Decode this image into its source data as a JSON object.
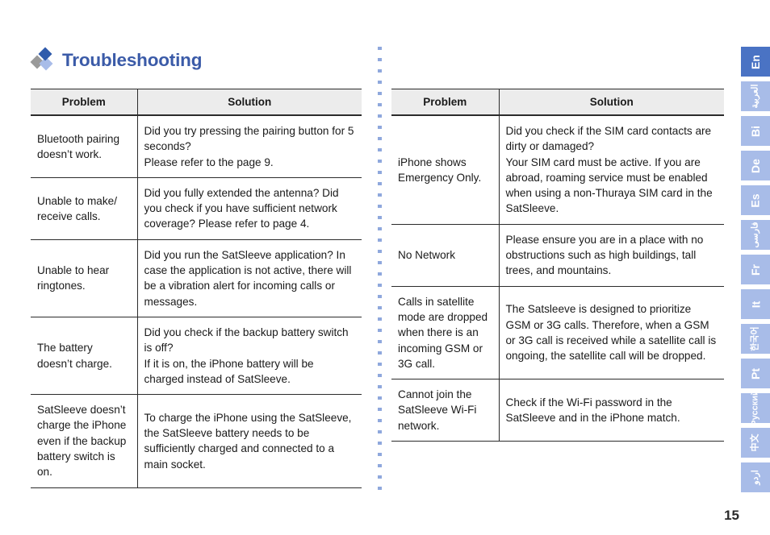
{
  "page": {
    "title": "Troubleshooting",
    "title_icon": "diamonds-icon",
    "number": "15",
    "accent_color": "#3b5ba8",
    "tab_color": "#a8bce8",
    "tab_active_color": "#4a73c4",
    "header_bg": "#ececec"
  },
  "tables": [
    {
      "name": "troubleshooting-table-left",
      "columns": [
        "Problem",
        "Solution"
      ],
      "rows": [
        {
          "problem": "Bluetooth pairing doesn’t work.",
          "solution": "Did you try pressing the pairing button for 5 seconds?\nPlease refer to the page 9."
        },
        {
          "problem": "Unable to  make/ receive calls.",
          "solution": "Did you fully extended the antenna? Did you check if you have sufficient network coverage? Please refer to page 4."
        },
        {
          "problem": "Unable to hear ringtones.",
          "solution": "Did you run the SatSleeve application? In case the application is not active, there will be a vibration alert for incoming calls or messages."
        },
        {
          "problem": "The battery doesn’t charge.",
          "solution": "Did you check if the backup battery switch is off?\nIf it is on, the iPhone battery will be charged instead of SatSleeve."
        },
        {
          "problem": "SatSleeve doesn’t charge the iPhone even if the backup battery switch is on.",
          "solution": "To charge the iPhone using the SatSleeve, the SatSleeve battery needs to be sufficiently charged and connected to a main socket."
        }
      ]
    },
    {
      "name": "troubleshooting-table-right",
      "columns": [
        "Problem",
        "Solution"
      ],
      "rows": [
        {
          "problem": "iPhone shows Emergency Only.",
          "solution": "Did you check if the SIM card contacts are dirty or damaged?\nYour SIM card must be active. If you are abroad, roaming service must be enabled when using a non-Thuraya SIM card in the SatSleeve."
        },
        {
          "problem": "No Network",
          "solution": "Please ensure you are in a place with no obstructions such as high buildings, tall trees, and mountains."
        },
        {
          "problem": "Calls in satellite mode are dropped when there is an incoming GSM or 3G call.",
          "solution": "The Satsleeve is designed  to prioritize GSM or 3G calls. Therefore, when a GSM or 3G call is received while a satellite call is ongoing, the satellite call will be dropped."
        },
        {
          "problem": "Cannot join the SatSleeve Wi-Fi network.",
          "solution": "Check if the Wi-Fi password in the SatSleeve and in the iPhone match."
        }
      ]
    }
  ],
  "language_tabs": [
    {
      "label": "En",
      "active": true,
      "small": false
    },
    {
      "label": "العربية",
      "active": false,
      "small": true
    },
    {
      "label": "Bi",
      "active": false,
      "small": false
    },
    {
      "label": "De",
      "active": false,
      "small": false
    },
    {
      "label": "Es",
      "active": false,
      "small": false
    },
    {
      "label": "فارسی",
      "active": false,
      "small": true
    },
    {
      "label": "Fr",
      "active": false,
      "small": false
    },
    {
      "label": "It",
      "active": false,
      "small": false
    },
    {
      "label": "한국어",
      "active": false,
      "small": true
    },
    {
      "label": "Pt",
      "active": false,
      "small": false
    },
    {
      "label": "Русский",
      "active": false,
      "small": true
    },
    {
      "label": "中文",
      "active": false,
      "small": true
    },
    {
      "label": "اردو",
      "active": false,
      "small": true
    }
  ]
}
